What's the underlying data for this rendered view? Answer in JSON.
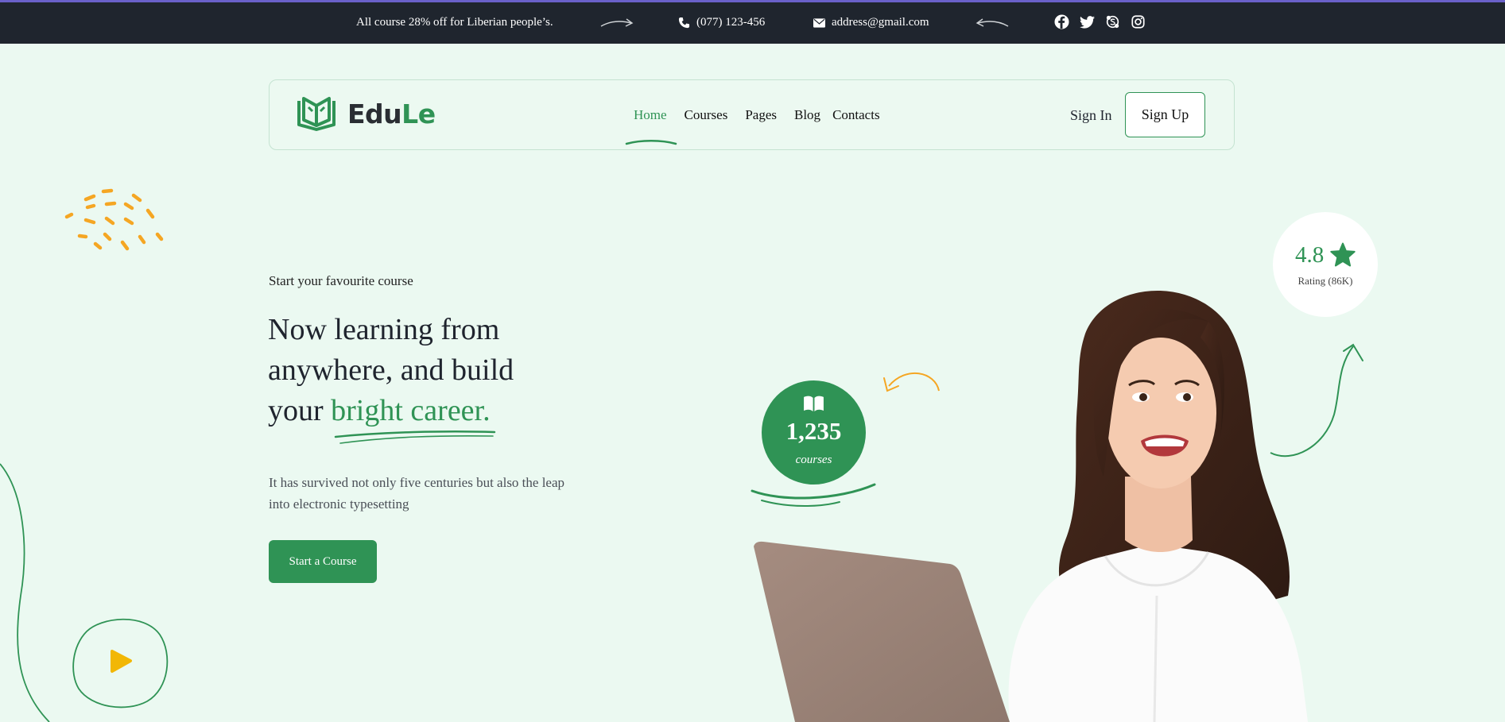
{
  "topbar": {
    "promo": "All course 28% off for Liberian people’s.",
    "phone": "(077) 123-456",
    "email": "address@gmail.com",
    "social": [
      "facebook-icon",
      "twitter-icon",
      "skype-icon",
      "instagram-icon"
    ]
  },
  "nav": {
    "logo_part1": "Edu",
    "logo_part2": "Le",
    "items": [
      "Home",
      "Courses",
      "Pages",
      "Blog",
      "Contacts"
    ],
    "active": "Home",
    "signin": "Sign In",
    "signup": "Sign Up"
  },
  "hero": {
    "eyebrow": "Start your favourite course",
    "headline_line1": "Now learning from",
    "headline_line2": "anywhere, and build",
    "headline_line3_plain": "your ",
    "headline_highlight": "bright career.",
    "description": "It has survived not only five centuries but also the leap into electronic typesetting",
    "cta": "Start a Course"
  },
  "stats": {
    "courses_count": "1,235",
    "courses_label": "courses",
    "rating_value": "4.8",
    "rating_label": "Rating (86K)"
  },
  "colors": {
    "brand_green": "#2f9355",
    "topbar_bg": "#1f252e",
    "page_bg": "#ebf9f1",
    "accent_orange": "#f5a623",
    "play_yellow": "#f2b705"
  }
}
